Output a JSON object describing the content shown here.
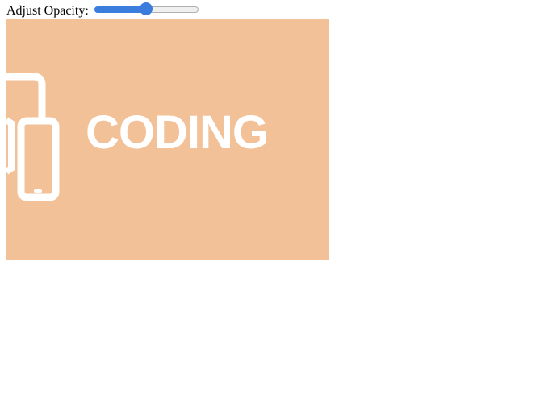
{
  "control": {
    "label": "Adjust Opacity:",
    "opacity_value": 0.5,
    "slider_min": 0,
    "slider_max": 1
  },
  "image": {
    "text": "CODING",
    "background_color": "#f3c198",
    "foreground_color": "#ffffff",
    "icon": "mobile-devices-icon"
  },
  "colors": {
    "slider_accent": "#3b7ddd"
  }
}
